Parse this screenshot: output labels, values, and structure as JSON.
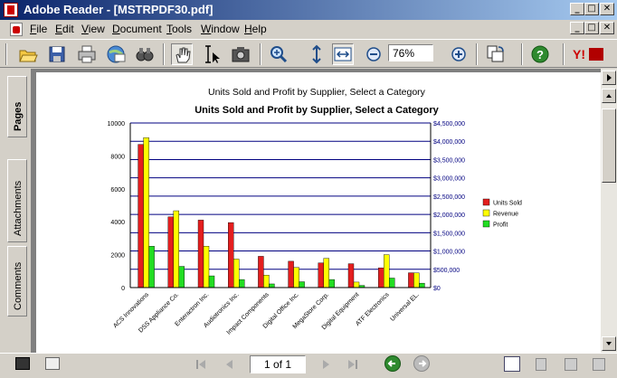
{
  "window": {
    "title": "Adobe Reader - [MSTRPDF30.pdf]",
    "min_glyph": "_",
    "max_glyph": "□",
    "close_glyph": "✕"
  },
  "menu": {
    "items": [
      "File",
      "Edit",
      "View",
      "Document",
      "Tools",
      "Window",
      "Help"
    ]
  },
  "toolbar": {
    "zoom_value": "76%",
    "icons": [
      "open-icon",
      "save-icon",
      "print-icon",
      "email-icon",
      "search-icon",
      "hand-icon",
      "select-text-icon",
      "snapshot-icon",
      "zoom-in-tool-icon",
      "fit-page-icon",
      "fit-width-icon",
      "zoom-out-icon",
      "zoom-in-icon",
      "rotate-icon",
      "help-icon",
      "yahoo-icon"
    ]
  },
  "nav": {
    "tabs": [
      "Pages",
      "Attachments",
      "Comments"
    ]
  },
  "document": {
    "header": "Units Sold and Profit by Supplier, Select a Category"
  },
  "chart_data": {
    "type": "bar",
    "title": "Units Sold and Profit by Supplier, Select a Category",
    "categories": [
      "ACS Innovations",
      "DSS Appliance Co.",
      "Enteractron Inc.",
      "Audiotronics Inc.",
      "Impact Components",
      "Digital Office Inc.",
      "MegaStore Corp.",
      "Digital Equipment",
      "ATF Electronics",
      "Universal EL."
    ],
    "series": [
      {
        "name": "Units Sold",
        "axis": "left",
        "color": "#e41e1e",
        "values": [
          8700,
          4300,
          4100,
          3950,
          1900,
          1600,
          1500,
          1450,
          1200,
          900
        ]
      },
      {
        "name": "Revenue",
        "axis": "right",
        "color": "#ffff00",
        "values": [
          4100000,
          2100000,
          1130000,
          780000,
          340000,
          550000,
          800000,
          150000,
          900000,
          400000
        ]
      },
      {
        "name": "Profit",
        "axis": "right",
        "color": "#22dd22",
        "values": [
          1130000,
          580000,
          320000,
          220000,
          100000,
          160000,
          220000,
          60000,
          260000,
          120000
        ]
      }
    ],
    "y_left": {
      "min": 0,
      "max": 10000,
      "ticks": [
        "0",
        "2000",
        "4000",
        "6000",
        "8000",
        "10000"
      ]
    },
    "y_right": {
      "min": 0,
      "max": 4500000,
      "ticks": [
        "$0",
        "$500,000",
        "$1,000,000",
        "$1,500,000",
        "$2,000,000",
        "$2,500,000",
        "$3,000,000",
        "$3,500,000",
        "$4,000,000",
        "$4,500,000"
      ]
    },
    "grid": true,
    "legend_position": "right"
  },
  "statusbar": {
    "page_indicator": "1 of 1"
  },
  "colors": {
    "titlebar_start": "#0a246a",
    "titlebar_end": "#a6caf0",
    "chrome": "#d4d0c8"
  }
}
